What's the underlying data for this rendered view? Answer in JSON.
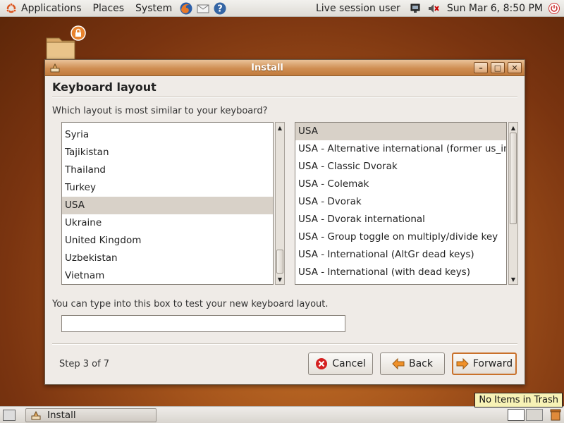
{
  "top_panel": {
    "menus": [
      "Applications",
      "Places",
      "System"
    ],
    "user": "Live session user",
    "clock": "Sun Mar  6,  8:50 PM"
  },
  "dialog": {
    "title": "Install",
    "heading": "Keyboard layout",
    "prompt": "Which layout is most similar to your keyboard?",
    "countries": [
      "Syria",
      "Tajikistan",
      "Thailand",
      "Turkey",
      "USA",
      "Ukraine",
      "United Kingdom",
      "Uzbekistan",
      "Vietnam"
    ],
    "selected_country": "USA",
    "variants": [
      "USA",
      "USA - Alternative international (former us_intl)",
      "USA - Classic Dvorak",
      "USA - Colemak",
      "USA - Dvorak",
      "USA - Dvorak international",
      "USA - Group toggle on multiply/divide key",
      "USA - International (AltGr dead keys)",
      "USA - International (with dead keys)"
    ],
    "selected_variant": "USA",
    "test_hint": "You can type into this box to test your new keyboard layout.",
    "test_input_value": "",
    "step": "Step 3 of 7",
    "cancel_label": "Cancel",
    "back_label": "Back",
    "forward_label": "Forward"
  },
  "bottom_panel": {
    "task_label": "Install",
    "tooltip": "No Items in Trash"
  },
  "colors": {
    "accent": "#c9712b",
    "titlebar": "#cf8e52",
    "selection": "#d8d1c8"
  }
}
